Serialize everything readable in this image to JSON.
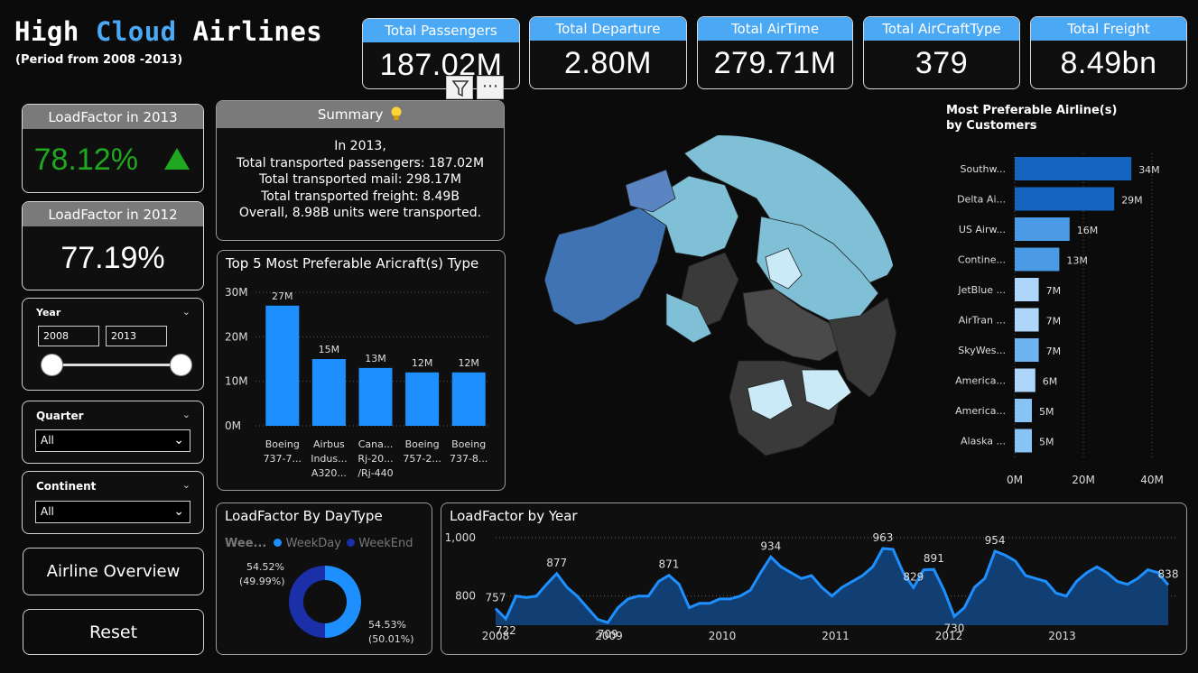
{
  "header": {
    "title_part1": "High ",
    "title_part2": "Cloud",
    "title_part3": " Airlines",
    "subtitle": "(Period from 2008 -2013)",
    "accent_color": "#4aa8f5"
  },
  "kpis": [
    {
      "label": "Total Passengers",
      "value": "187.02M"
    },
    {
      "label": "Total Departure",
      "value": "2.80M"
    },
    {
      "label": "Total AirTime",
      "value": "279.71M"
    },
    {
      "label": "Total AirCraftType",
      "value": "379"
    },
    {
      "label": "Total Freight",
      "value": "8.49bn"
    }
  ],
  "visual_toolbar": {
    "filter_icon": "filter-icon",
    "more_icon": "more-options-icon",
    "more_glyph": "⋯"
  },
  "loadfactor_2013": {
    "label": "LoadFactor in 2013",
    "value": "78.12%",
    "color": "#1fa81f",
    "trend_icon": "up-arrow-icon"
  },
  "loadfactor_2012": {
    "label": "LoadFactor in 2012",
    "value": "77.19%"
  },
  "summary": {
    "title": "Summary",
    "icon": "lightbulb-icon",
    "lines": [
      "In 2013,",
      "Total transported passengers: 187.02M",
      "Total transported mail: 298.17M",
      "Total transported freight: 8.49B",
      "Overall, 8.98B units were transported."
    ]
  },
  "slicers": {
    "year": {
      "label": "Year",
      "from": "2008",
      "to": "2013"
    },
    "quarter": {
      "label": "Quarter",
      "value": "All"
    },
    "continent": {
      "label": "Continent",
      "value": "All"
    }
  },
  "buttons": {
    "airline_overview": "Airline Overview",
    "reset": "Reset"
  },
  "chart_data": [
    {
      "id": "aircraft",
      "type": "bar",
      "title": "Top 5 Most Preferable Aricraft(s) Type",
      "categories": [
        [
          "Boeing",
          "737-7..."
        ],
        [
          "Airbus",
          "Indus...",
          "A320..."
        ],
        [
          "Cana...",
          "Rj-20...",
          "/Rj-440"
        ],
        [
          "Boeing",
          "757-2..."
        ],
        [
          "Boeing",
          "737-8..."
        ]
      ],
      "values": [
        27,
        15,
        13,
        12,
        12
      ],
      "data_labels": [
        "27M",
        "15M",
        "13M",
        "12M",
        "12M"
      ],
      "y_ticks": [
        "0M",
        "10M",
        "20M",
        "30M"
      ],
      "ylim": [
        0,
        30
      ],
      "color": "#1e8fff"
    },
    {
      "id": "airlines",
      "type": "bar",
      "orientation": "horizontal",
      "title": "Most Preferable Airline(s) by Customers",
      "categories": [
        "Southw...",
        "Delta Ai...",
        "US Airw...",
        "Contine...",
        "JetBlue ...",
        "AirTran ...",
        "SkyWes...",
        "America...",
        "America...",
        "Alaska ..."
      ],
      "values": [
        34,
        29,
        16,
        13,
        7,
        7,
        7,
        6,
        5,
        5
      ],
      "data_labels": [
        "34M",
        "29M",
        "16M",
        "13M",
        "7M",
        "7M",
        "7M",
        "6M",
        "5M",
        "5M"
      ],
      "x_ticks": [
        "0M",
        "20M",
        "40M"
      ],
      "xlim": [
        0,
        40
      ],
      "colors": [
        "#1565c0",
        "#1565c0",
        "#4a9ae6",
        "#4a9ae6",
        "#aed6fa",
        "#aed6fa",
        "#6eb4f2",
        "#aed6fa",
        "#87c3f5",
        "#87c3f5"
      ]
    },
    {
      "id": "daytype",
      "type": "pie",
      "title": "LoadFactor By DayType",
      "legend_title": "Wee...",
      "series": [
        {
          "name": "WeekDay",
          "value": 50.01,
          "label": "54.53%",
          "sublabel": "(50.01%)",
          "color": "#1e8fff"
        },
        {
          "name": "WeekEnd",
          "value": 49.99,
          "label": "54.52%",
          "sublabel": "(49.99%)",
          "color": "#1a2fa8"
        }
      ]
    },
    {
      "id": "year",
      "type": "area",
      "title": "LoadFactor by Year",
      "x_labels": [
        "2008",
        "2009",
        "2010",
        "2011",
        "2012",
        "2013"
      ],
      "y_ticks": [
        "800",
        "1,000"
      ],
      "ylim": [
        700,
        1000
      ],
      "values": [
        757,
        722,
        800,
        795,
        800,
        840,
        877,
        830,
        800,
        760,
        720,
        709,
        760,
        790,
        800,
        800,
        850,
        871,
        840,
        760,
        775,
        775,
        790,
        790,
        800,
        820,
        880,
        934,
        900,
        880,
        860,
        870,
        830,
        800,
        830,
        850,
        870,
        900,
        963,
        960,
        880,
        829,
        890,
        891,
        820,
        730,
        760,
        830,
        860,
        954,
        940,
        920,
        870,
        860,
        850,
        810,
        800,
        850,
        880,
        900,
        880,
        850,
        840,
        860,
        890,
        880,
        838
      ],
      "labels": [
        {
          "i": 0,
          "text": "757"
        },
        {
          "i": 1,
          "text": "722"
        },
        {
          "i": 6,
          "text": "877"
        },
        {
          "i": 11,
          "text": "709"
        },
        {
          "i": 17,
          "text": "871"
        },
        {
          "i": 27,
          "text": "934"
        },
        {
          "i": 38,
          "text": "963"
        },
        {
          "i": 41,
          "text": "829"
        },
        {
          "i": 43,
          "text": "891"
        },
        {
          "i": 45,
          "text": "730"
        },
        {
          "i": 49,
          "text": "954"
        },
        {
          "i": 66,
          "text": "838"
        }
      ],
      "line_color": "#1e8fff",
      "fill_color": "#123f73"
    }
  ]
}
